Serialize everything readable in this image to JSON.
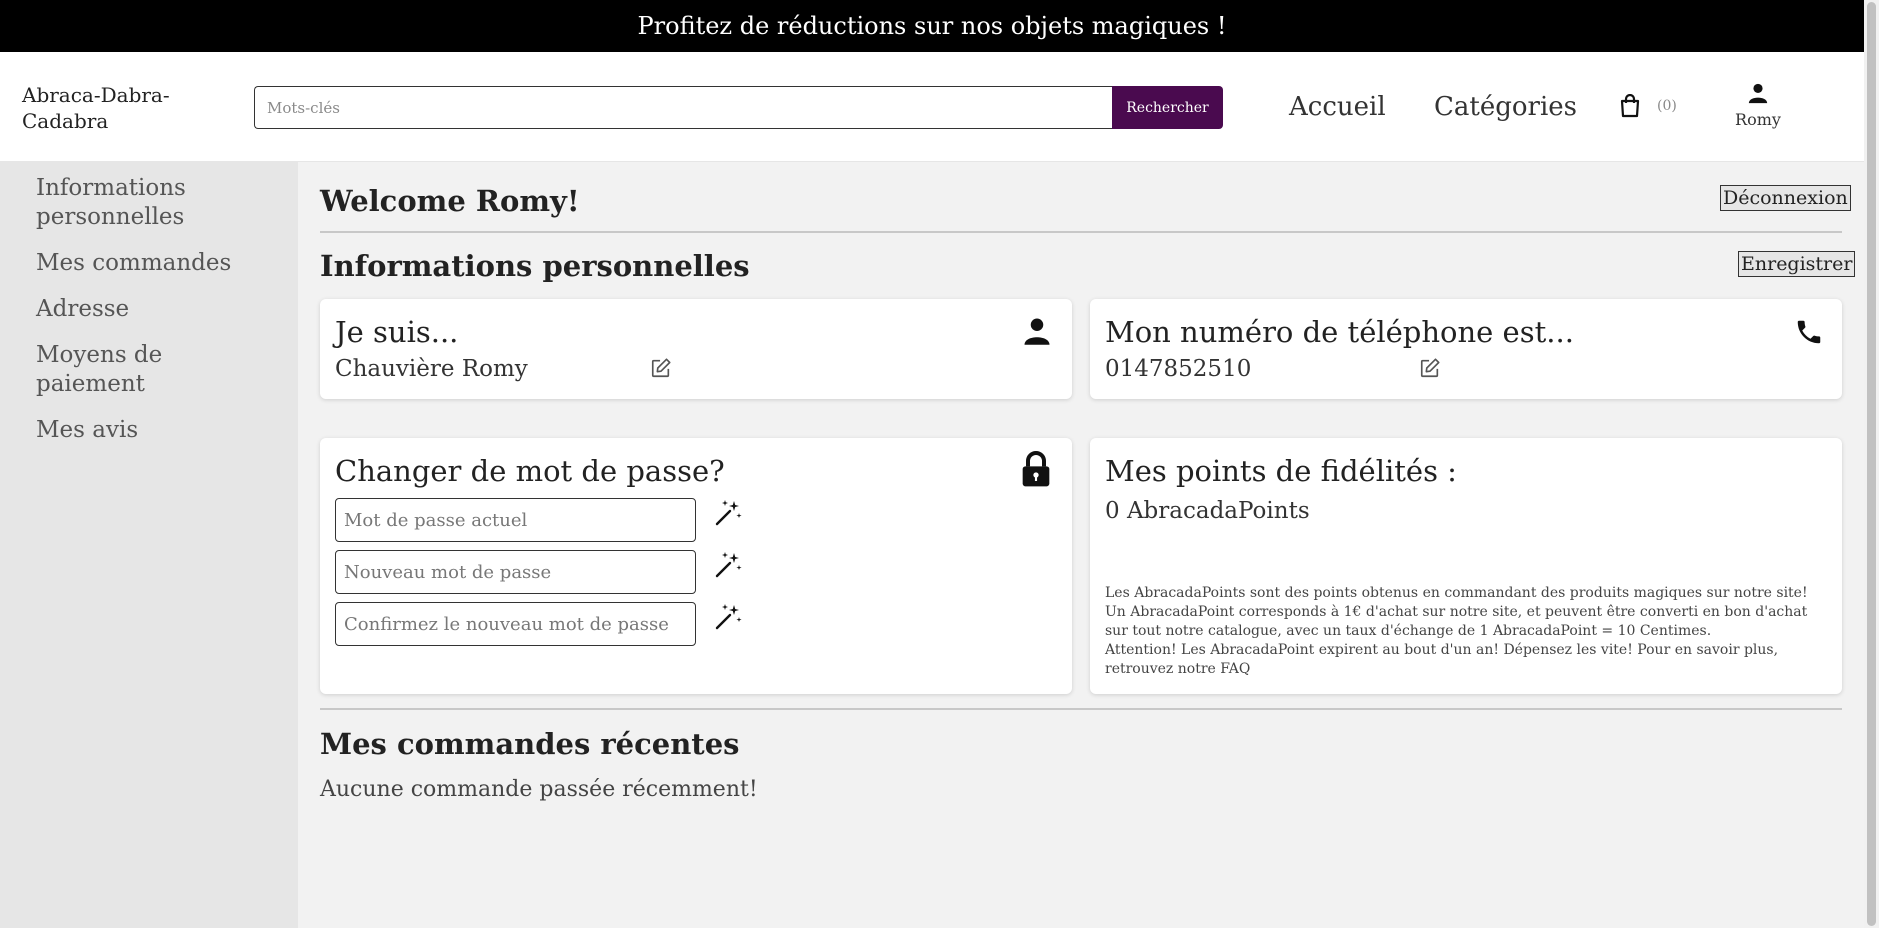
{
  "promo": {
    "text": "Profitez de réductions sur nos objets magiques !"
  },
  "header": {
    "logo": "Abraca-Dabra-Cadabra",
    "search": {
      "placeholder": "Mots-clés",
      "value": "",
      "button_label": "Rechercher"
    },
    "nav": {
      "home": "Accueil",
      "categories": "Catégories"
    },
    "cart": {
      "count": "(0)",
      "icon": "shopping-bag-icon"
    },
    "account": {
      "name": "Romy",
      "icon": "user-icon"
    }
  },
  "sidebar": {
    "items": [
      {
        "label": "Informations personnelles"
      },
      {
        "label": "Mes commandes"
      },
      {
        "label": "Adresse"
      },
      {
        "label": "Moyens de paiement"
      },
      {
        "label": "Mes avis"
      }
    ]
  },
  "main": {
    "welcome": "Welcome Romy!",
    "logout_label": "Déconnexion",
    "personal_title": "Informations personnelles",
    "save_label": "Enregistrer",
    "identity": {
      "title": "Je suis...",
      "value": "Chauvière Romy",
      "icon": "user-icon"
    },
    "phone": {
      "title": "Mon numéro de téléphone est...",
      "value": "0147852510",
      "icon": "phone-icon"
    },
    "password": {
      "title": "Changer de mot de passe?",
      "icon": "lock-icon",
      "current_placeholder": "Mot de passe actuel",
      "new_placeholder": "Nouveau mot de passe",
      "confirm_placeholder": "Confirmez le nouveau mot de passe"
    },
    "loyalty": {
      "title": "Mes points de fidélités :",
      "points": "0 AbracadaPoints",
      "description": "Les AbracadaPoints sont des points obtenus en commandant des produits magiques sur notre site! Un AbracadaPoint corresponds à 1€ d'achat sur notre site, et peuvent être converti en bon d'achat sur tout notre catalogue, avec un taux d'échange de 1 AbracadaPoint = 10 Centimes.",
      "warning": "Attention! Les AbracadaPoint expirent au bout d'un an! Dépensez les vite! Pour en savoir plus, retrouvez notre FAQ"
    },
    "orders": {
      "title": "Mes commandes récentes",
      "empty_message": "Aucune commande passée récemment!"
    }
  },
  "colors": {
    "accent": "#4a0a4f",
    "promo_bg": "#000000",
    "sidebar_bg": "#e6e6e6",
    "main_bg": "#f2f2f2"
  }
}
